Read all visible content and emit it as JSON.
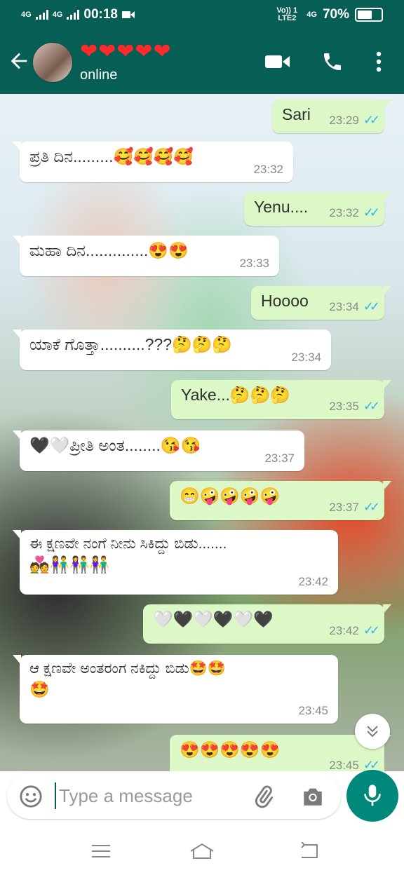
{
  "status_bar": {
    "network_left": "4G",
    "network_left2": "4G",
    "time": "00:18",
    "volte": "Vo)) 1 LTE2",
    "network_right": "4G",
    "battery": "70%",
    "battery_level": 0.7
  },
  "header": {
    "contact_name": "❤❤❤❤❤",
    "status": "online"
  },
  "messages": [
    {
      "side": "out",
      "text": "Sari",
      "time": "23:29",
      "read": "✓✓"
    },
    {
      "side": "in",
      "text": "ಪ್ರತಿ ದಿನ.........🥰🥰🥰🥰",
      "time": "23:32"
    },
    {
      "side": "out",
      "text": "Yenu....",
      "time": "23:32",
      "read": "✓✓"
    },
    {
      "side": "in",
      "text": "ಮಹಾ ದಿನ..............😍😍",
      "time": "23:33"
    },
    {
      "side": "out",
      "text": "Hoooo",
      "time": "23:34",
      "read": "✓✓"
    },
    {
      "side": "in",
      "text": "ಯಾಕೆ ಗೊತ್ತಾ..........???🤔🤔🤔",
      "time": "23:34"
    },
    {
      "side": "out",
      "text": "Yake...🤔🤔🤔",
      "time": "23:35",
      "read": "✓✓"
    },
    {
      "side": "in",
      "text": "🖤🤍ಪ್ರೀತಿ ಅಂತ........😘😘",
      "time": "23:37"
    },
    {
      "side": "out",
      "text": "😁🤪🤪🤪🤪",
      "time": "23:37",
      "read": "✓✓"
    },
    {
      "side": "in",
      "text": "ಈ ಕ್ಷಣವೇ ನಂಗೆ ನೀನು ಸಿಕಿದ್ದು ಬಿಡು.......",
      "text2": "💑👫👫👫",
      "time": "23:42"
    },
    {
      "side": "out",
      "text": "🤍🖤🤍🖤🤍🖤",
      "time": "23:42",
      "read": "✓✓"
    },
    {
      "side": "in",
      "text": "ಆ ಕ್ಷಣವೇ ಅಂತರಂಗ ನಕಿದ್ದು  ಬಿಡು🤩🤩",
      "text2": "🤩",
      "time": "23:45"
    },
    {
      "side": "out",
      "text": "😍😍😍😍😍",
      "time": "23:45",
      "read": "✓✓"
    }
  ],
  "composer": {
    "placeholder": "Type a message"
  },
  "icons": {
    "back": "arrow-left-icon",
    "video": "video-call-icon",
    "call": "phone-icon",
    "menu": "more-vert-icon",
    "emoji": "emoji-icon",
    "attach": "paperclip-icon",
    "camera": "camera-icon",
    "mic": "mic-icon",
    "scroll": "chevron-double-down-icon"
  },
  "colors": {
    "header": "#075e54",
    "outgoing_bubble": "#dcf8c6",
    "incoming_bubble": "#ffffff",
    "read_ticks": "#34b7f1",
    "mic_button": "#00897b"
  }
}
